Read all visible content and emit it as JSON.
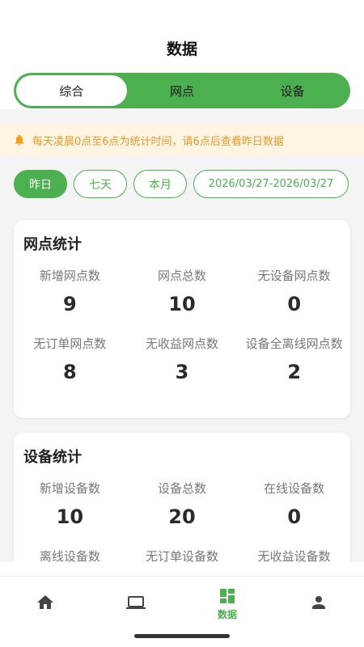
{
  "header": {
    "title": "数据"
  },
  "segments": [
    {
      "label": "综合",
      "active": true
    },
    {
      "label": "网点",
      "active": false
    },
    {
      "label": "设备",
      "active": false
    }
  ],
  "notice": {
    "icon": "bell-icon",
    "text": "每天凌晨0点至6点为统计时间，请6点后查看昨日数据",
    "color": "#e39a2b"
  },
  "filters": [
    {
      "label": "昨日",
      "active": true
    },
    {
      "label": "七天",
      "active": false
    },
    {
      "label": "本月",
      "active": false
    },
    {
      "label": "2026/03/27-2026/03/27",
      "active": false
    }
  ],
  "outlet_stats": {
    "title": "网点统计",
    "items": [
      {
        "label": "新增网点数",
        "value": "9"
      },
      {
        "label": "网点总数",
        "value": "10"
      },
      {
        "label": "无设备网点数",
        "value": "0"
      },
      {
        "label": "无订单网点数",
        "value": "8"
      },
      {
        "label": "无收益网点数",
        "value": "3"
      },
      {
        "label": "设备全离线网点数",
        "value": "2"
      }
    ]
  },
  "device_stats": {
    "title": "设备统计",
    "items": [
      {
        "label": "新增设备数",
        "value": "10"
      },
      {
        "label": "设备总数",
        "value": "20"
      },
      {
        "label": "在线设备数",
        "value": "0"
      },
      {
        "label": "离线设备数",
        "value": ""
      },
      {
        "label": "无订单设备数",
        "value": ""
      },
      {
        "label": "无收益设备数",
        "value": ""
      }
    ]
  },
  "tabbar": {
    "items": [
      {
        "icon": "home-icon",
        "label": "",
        "active": false
      },
      {
        "icon": "laptop-icon",
        "label": "",
        "active": false
      },
      {
        "icon": "dashboard-icon",
        "label": "数据",
        "active": true
      },
      {
        "icon": "person-icon",
        "label": "",
        "active": false
      }
    ]
  },
  "colors": {
    "accent": "#4caf50",
    "notice_bg": "#fdf5e2",
    "page_bg": "#f4f4f4"
  }
}
